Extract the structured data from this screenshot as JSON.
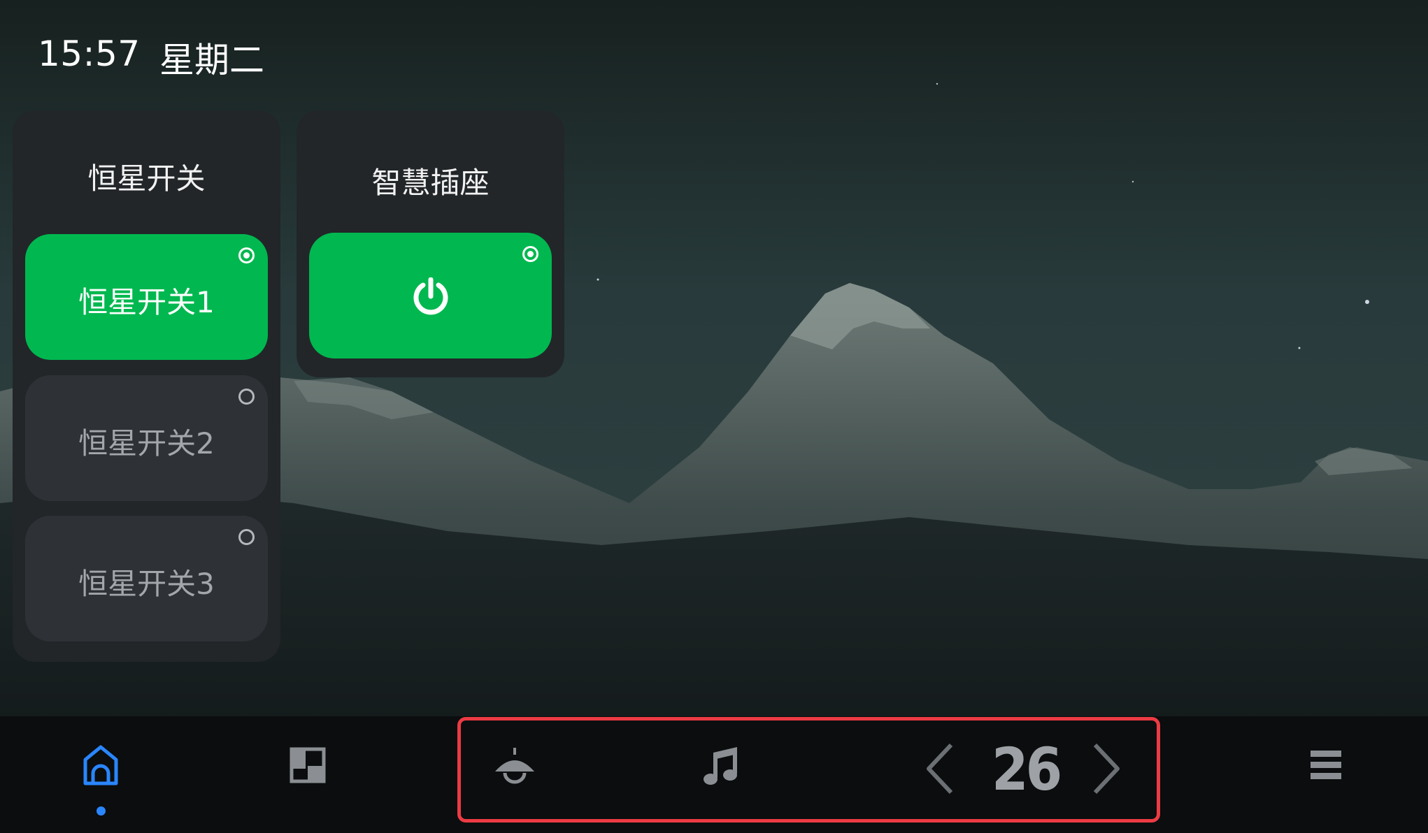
{
  "status": {
    "time": "15:57",
    "weekday": "星期二"
  },
  "panels": {
    "switch": {
      "title": "恒星开关",
      "items": [
        {
          "label": "恒星开关1",
          "selected": true
        },
        {
          "label": "恒星开关2",
          "selected": false
        },
        {
          "label": "恒星开关3",
          "selected": false
        }
      ]
    },
    "socket": {
      "title": "智慧插座",
      "selected": true,
      "icon": "power-icon"
    }
  },
  "bottom_nav": {
    "items": [
      "home-icon",
      "layout-icon",
      "ceiling-lamp-icon",
      "music-note-icon",
      "chevron-left-icon",
      "chevron-right-icon",
      "menu-icon"
    ],
    "active": "home-icon",
    "temperature": "26"
  },
  "colors": {
    "accent_green": "#00b84f",
    "active_blue": "#2a86ff",
    "highlight_red": "#ec3b44"
  }
}
